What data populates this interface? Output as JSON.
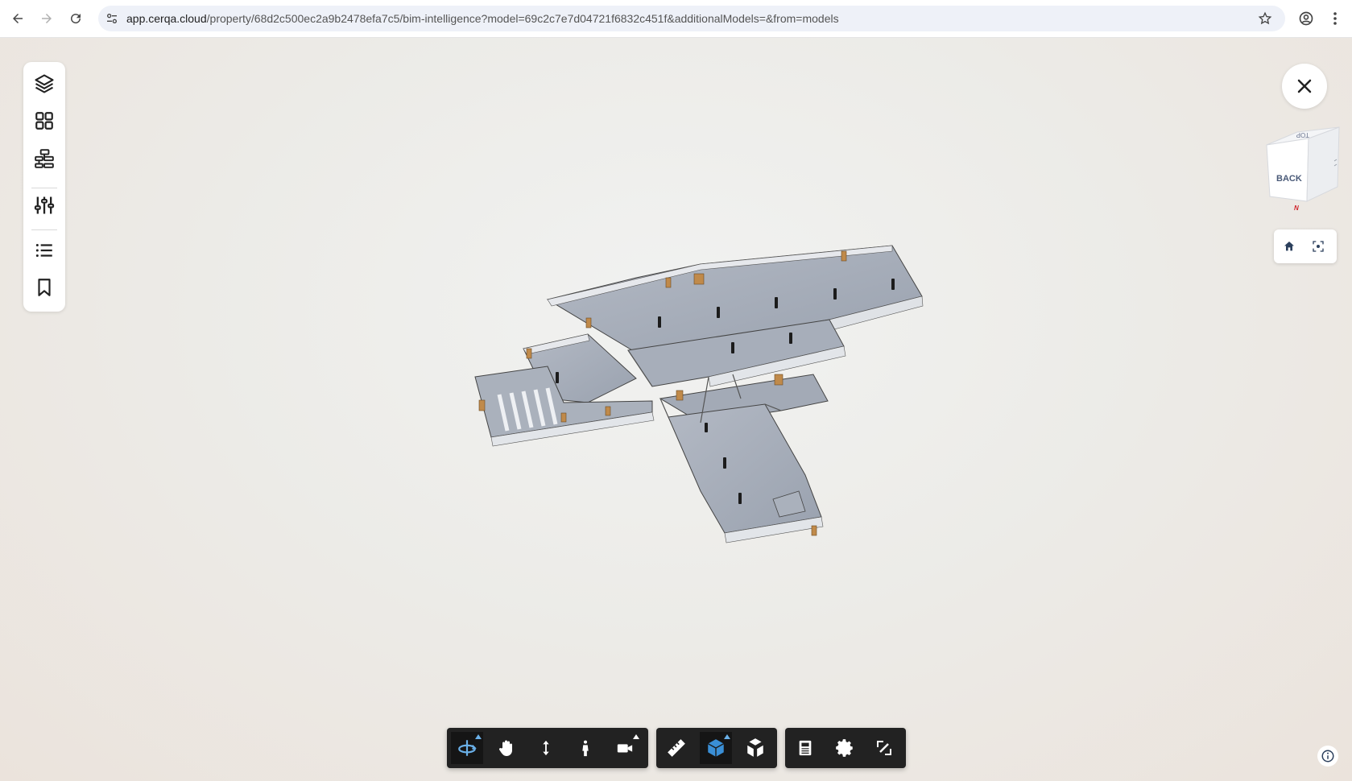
{
  "browser": {
    "url_host": "app.cerqa.cloud",
    "url_path": "/property/68d2c500ec2a9b2478efa7c5/bim-intelligence?model=69c2c7e7d04721f6832c451f&additionalModels=&from=models",
    "icons": [
      "back-arrow-icon",
      "forward-arrow-icon",
      "reload-icon",
      "site-info-icon",
      "star-icon",
      "profile-icon",
      "kebab-menu-icon"
    ]
  },
  "sidebar": {
    "items": [
      {
        "name": "layers",
        "icon": "layers-icon"
      },
      {
        "name": "grid",
        "icon": "grid-icon"
      },
      {
        "name": "hierarchy",
        "icon": "hierarchy-icon"
      },
      {
        "name": "sliders",
        "icon": "sliders-icon"
      },
      {
        "name": "list",
        "icon": "list-icon"
      },
      {
        "name": "bookmark",
        "icon": "bookmark-icon"
      }
    ]
  },
  "viewcube": {
    "top_label": "TOP",
    "front_label": "BACK",
    "compass_label": "N"
  },
  "view_controls": {
    "icons": [
      "home-icon",
      "fit-view-icon"
    ]
  },
  "toolbar": {
    "groups": [
      [
        "orbit-icon",
        "pan-hand-icon",
        "zoom-updown-icon",
        "walk-person-icon",
        "camera-icon"
      ],
      [
        "measure-ruler-icon",
        "section-cube-icon",
        "explode-model-icon"
      ],
      [
        "properties-panel-icon",
        "settings-gear-icon",
        "fullscreen-icon"
      ]
    ],
    "active": [
      "orbit-icon",
      "section-cube-icon"
    ]
  },
  "colors": {
    "toolbar_bg": "#222222",
    "active_accent": "#6ab0e8",
    "floor": "#a3aab6",
    "wall": "#e6e8ec",
    "door": "#c08a4a"
  }
}
